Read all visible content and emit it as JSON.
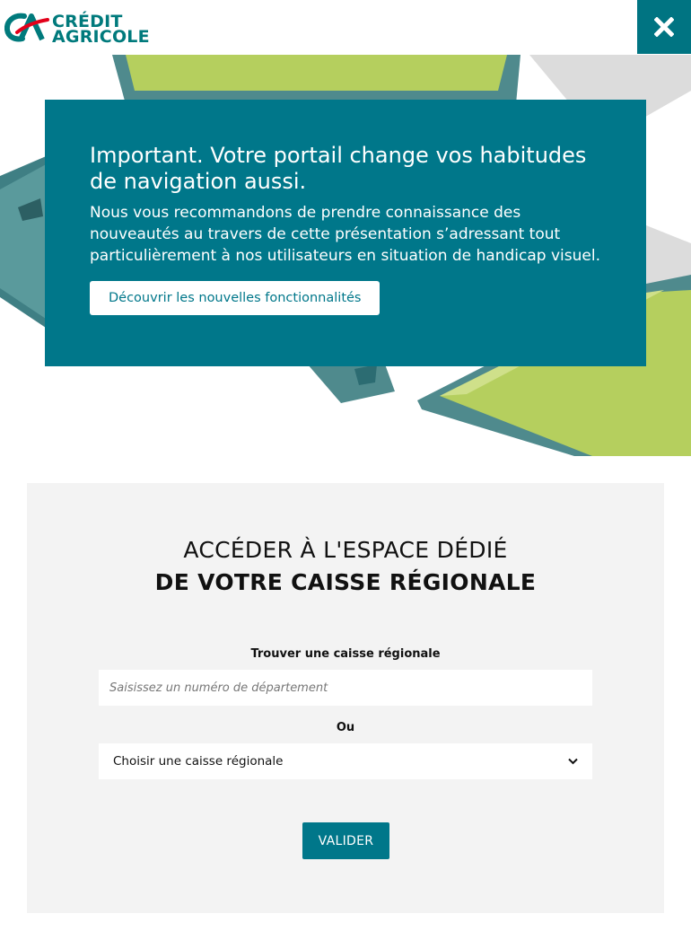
{
  "header": {
    "logo_line1": "CRÉDIT",
    "logo_line2": "AGRICOLE",
    "close_icon": "close-icon"
  },
  "hero": {
    "title": "Important. Votre portail change vos habitudes de navigation aussi.",
    "text": "Nous vous recommandons de prendre connaissance des nouveautés au travers de cette présentation s’adressant tout particulièrement à nos utilisateurs en situation de handicap visuel.",
    "button_label": "Découvrir les nouvelles fonctionnalités"
  },
  "form": {
    "title_line1": "ACCÉDER À L'ESPACE DÉDIÉ",
    "title_line2": "DE VOTRE CAISSE RÉGIONALE",
    "find_label": "Trouver une caisse régionale",
    "department_placeholder": "Saisissez un numéro de département",
    "or_label": "Ou",
    "select_value": "Choisir une caisse régionale",
    "validate_label": "VALIDER"
  },
  "colors": {
    "brand_teal": "#00778a",
    "logo_green": "#007a7c",
    "hero_lime": "#b5cf5e",
    "panel_bg": "#f3f3f3"
  }
}
